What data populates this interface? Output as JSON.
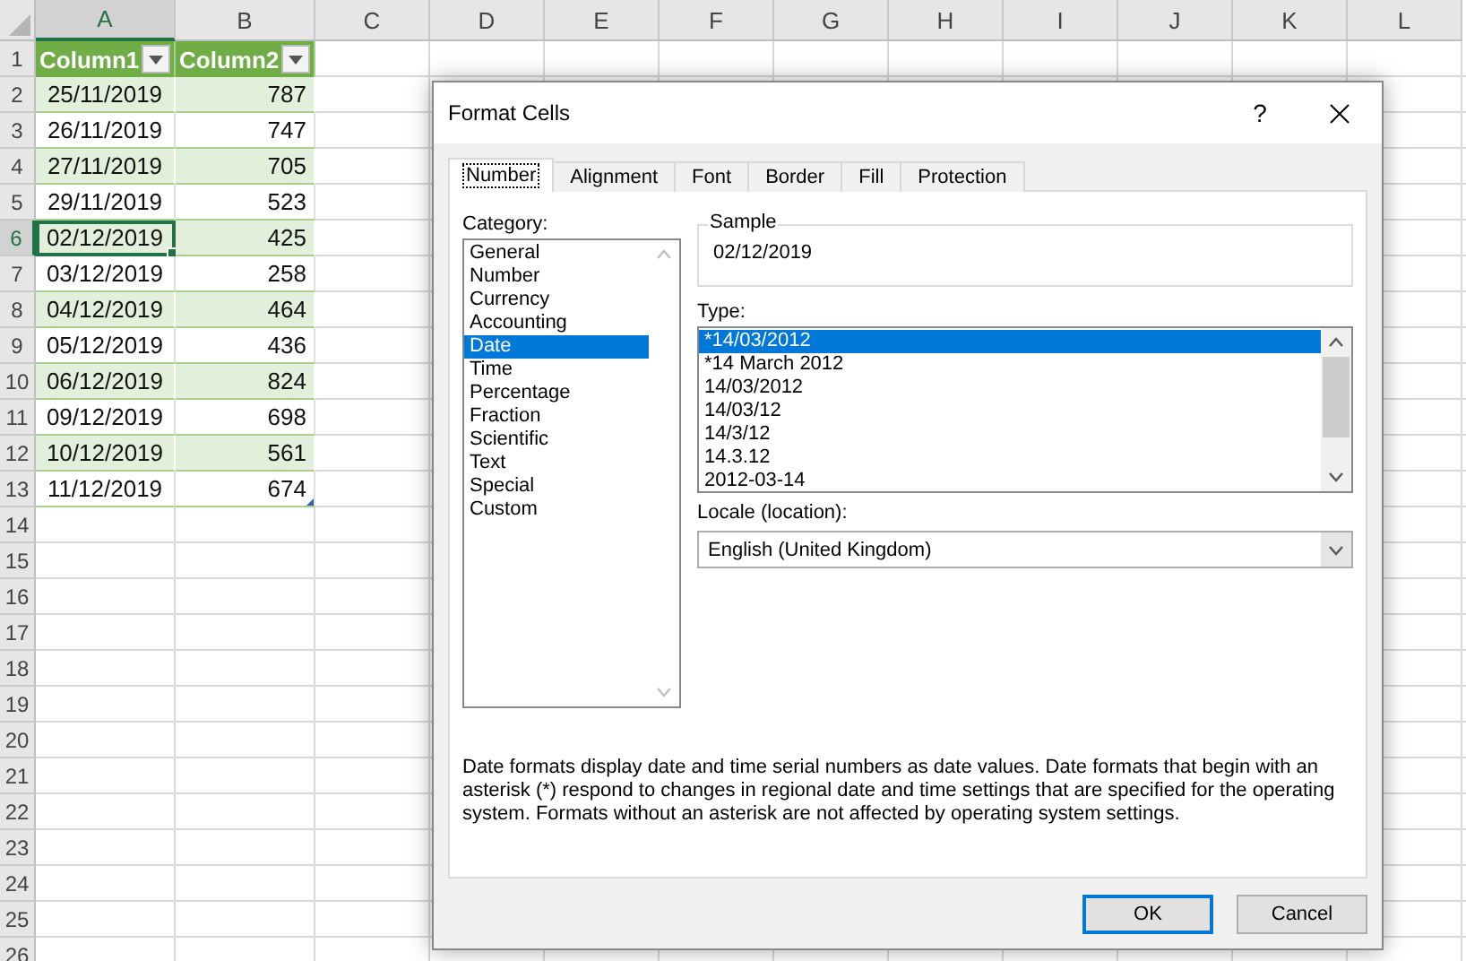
{
  "sheet": {
    "columns": [
      {
        "label": "A",
        "selected": true
      },
      {
        "label": "B",
        "selected": false
      },
      {
        "label": "C",
        "selected": false
      },
      {
        "label": "D",
        "selected": false
      },
      {
        "label": "E",
        "selected": false
      },
      {
        "label": "F",
        "selected": false
      },
      {
        "label": "G",
        "selected": false
      },
      {
        "label": "H",
        "selected": false
      },
      {
        "label": "I",
        "selected": false
      },
      {
        "label": "J",
        "selected": false
      },
      {
        "label": "K",
        "selected": false
      },
      {
        "label": "L",
        "selected": false
      }
    ],
    "row_numbers": [
      {
        "label": "1",
        "selected": false
      },
      {
        "label": "2",
        "selected": false
      },
      {
        "label": "3",
        "selected": false
      },
      {
        "label": "4",
        "selected": false
      },
      {
        "label": "5",
        "selected": false
      },
      {
        "label": "6",
        "selected": true
      },
      {
        "label": "7",
        "selected": false
      },
      {
        "label": "8",
        "selected": false
      },
      {
        "label": "9",
        "selected": false
      },
      {
        "label": "10",
        "selected": false
      },
      {
        "label": "11",
        "selected": false
      },
      {
        "label": "12",
        "selected": false
      },
      {
        "label": "13",
        "selected": false
      },
      {
        "label": "14",
        "selected": false
      },
      {
        "label": "15",
        "selected": false
      },
      {
        "label": "16",
        "selected": false
      },
      {
        "label": "17",
        "selected": false
      },
      {
        "label": "18",
        "selected": false
      },
      {
        "label": "19",
        "selected": false
      },
      {
        "label": "20",
        "selected": false
      },
      {
        "label": "21",
        "selected": false
      },
      {
        "label": "22",
        "selected": false
      },
      {
        "label": "23",
        "selected": false
      },
      {
        "label": "24",
        "selected": false
      },
      {
        "label": "25",
        "selected": false
      },
      {
        "label": "26",
        "selected": false
      }
    ],
    "table": {
      "columns": [
        "Column1",
        "Column2"
      ],
      "rows": [
        {
          "date": "25/11/2019",
          "value": "787",
          "selected": false
        },
        {
          "date": "26/11/2019",
          "value": "747",
          "selected": false
        },
        {
          "date": "27/11/2019",
          "value": "705",
          "selected": false
        },
        {
          "date": "29/11/2019",
          "value": "523",
          "selected": false
        },
        {
          "date": "02/12/2019",
          "value": "425",
          "selected": true
        },
        {
          "date": "03/12/2019",
          "value": "258",
          "selected": false
        },
        {
          "date": "04/12/2019",
          "value": "464",
          "selected": false
        },
        {
          "date": "05/12/2019",
          "value": "436",
          "selected": false
        },
        {
          "date": "06/12/2019",
          "value": "824",
          "selected": false
        },
        {
          "date": "09/12/2019",
          "value": "698",
          "selected": false
        },
        {
          "date": "10/12/2019",
          "value": "561",
          "selected": false
        },
        {
          "date": "11/12/2019",
          "value": "674",
          "selected": false
        }
      ]
    }
  },
  "dialog": {
    "title": "Format Cells",
    "help": "?",
    "tabs": [
      {
        "label": "Number",
        "selected": true
      },
      {
        "label": "Alignment",
        "selected": false
      },
      {
        "label": "Font",
        "selected": false
      },
      {
        "label": "Border",
        "selected": false
      },
      {
        "label": "Fill",
        "selected": false
      },
      {
        "label": "Protection",
        "selected": false
      }
    ],
    "category_label": "Category:",
    "categories": [
      {
        "label": "General",
        "selected": false
      },
      {
        "label": "Number",
        "selected": false
      },
      {
        "label": "Currency",
        "selected": false
      },
      {
        "label": "Accounting",
        "selected": false
      },
      {
        "label": "Date",
        "selected": true
      },
      {
        "label": "Time",
        "selected": false
      },
      {
        "label": "Percentage",
        "selected": false
      },
      {
        "label": "Fraction",
        "selected": false
      },
      {
        "label": "Scientific",
        "selected": false
      },
      {
        "label": "Text",
        "selected": false
      },
      {
        "label": "Special",
        "selected": false
      },
      {
        "label": "Custom",
        "selected": false
      }
    ],
    "sample": {
      "label": "Sample",
      "value": "02/12/2019"
    },
    "type_label": "Type:",
    "types": [
      {
        "label": "*14/03/2012",
        "selected": true
      },
      {
        "label": "*14 March 2012",
        "selected": false
      },
      {
        "label": "14/03/2012",
        "selected": false
      },
      {
        "label": "14/03/12",
        "selected": false
      },
      {
        "label": "14/3/12",
        "selected": false
      },
      {
        "label": "14.3.12",
        "selected": false
      },
      {
        "label": "2012-03-14",
        "selected": false
      }
    ],
    "locale_label": "Locale (location):",
    "locale": "English (United Kingdom)",
    "description": "Date formats display date and time serial numbers as date values.  Date formats that begin with an asterisk (*) respond to changes in regional date and time settings that are specified for the operating system. Formats without an asterisk are not affected by operating system settings.",
    "buttons": [
      {
        "label": "OK",
        "default": true
      },
      {
        "label": "Cancel",
        "default": false
      }
    ]
  }
}
